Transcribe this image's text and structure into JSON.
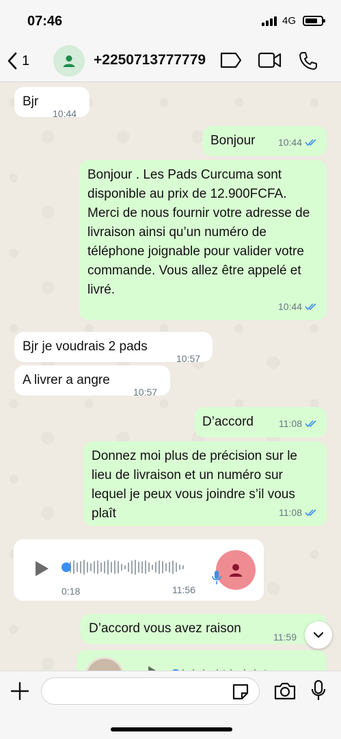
{
  "status": {
    "time": "07:46",
    "network": "4G"
  },
  "header": {
    "back_count": "1",
    "contact": "+2250713777779"
  },
  "messages": [
    {
      "dir": "in",
      "text": "Bjr",
      "time": "10:44"
    },
    {
      "dir": "out",
      "text": "Bonjour",
      "time": "10:44"
    },
    {
      "dir": "out",
      "text": "Bonjour . Les Pads Curcuma sont disponible au prix de 12.900FCFA. Merci de nous fournir votre adresse de livraison ainsi qu’un numéro de téléphone joignable pour valider votre commande. Vous allez être appelé et livré.",
      "time": "10:44"
    },
    {
      "dir": "in",
      "text": "Bjr je voudrais 2 pads",
      "time": "10:57"
    },
    {
      "dir": "in",
      "text": "A livrer a angre",
      "time": "10:57"
    },
    {
      "dir": "out",
      "text": "D’accord",
      "time": "11:08"
    },
    {
      "dir": "out",
      "text": "Donnez moi plus de précision sur le lieu de livraison et un numéro sur lequel je peux vous joindre s’il vous plaît",
      "time": "11:08"
    },
    {
      "dir": "out",
      "text": "D’accord vous avez raison",
      "time": "11:59"
    }
  ],
  "voice": {
    "duration": "0:18",
    "time": "11:56"
  },
  "input": {
    "placeholder": ""
  },
  "colors": {
    "outgoing": "#d9fdd3",
    "incoming": "#ffffff",
    "read_ticks": "#3a8ff0"
  }
}
